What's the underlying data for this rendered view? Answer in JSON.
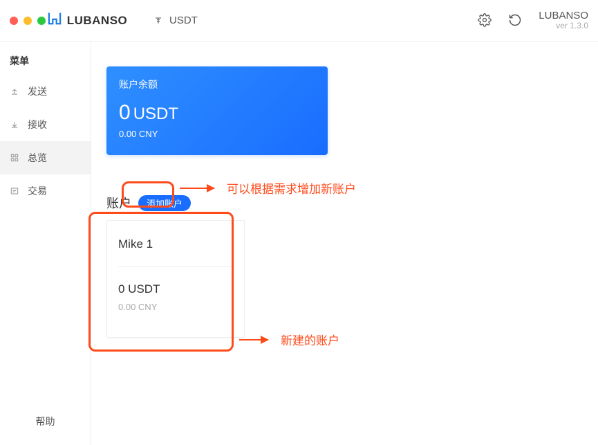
{
  "header": {
    "brand": "LUBANSO",
    "coin": "USDT",
    "brand_right": "LUBANSO",
    "version": "ver 1.3.0"
  },
  "sidebar": {
    "title": "菜单",
    "items": [
      {
        "label": "发送"
      },
      {
        "label": "接收"
      },
      {
        "label": "总览"
      },
      {
        "label": "交易"
      }
    ],
    "help": "帮助"
  },
  "balance": {
    "label": "账户余额",
    "amount": "0",
    "unit": "USDT",
    "sub": "0.00 CNY"
  },
  "accounts": {
    "title": "账户",
    "add_label": "添加账户",
    "card": {
      "name": "Mike 1",
      "balance": "0 USDT",
      "sub": "0.00 CNY"
    }
  },
  "annotations": {
    "a1": "可以根据需求增加新账户",
    "a2": "新建的账户"
  }
}
